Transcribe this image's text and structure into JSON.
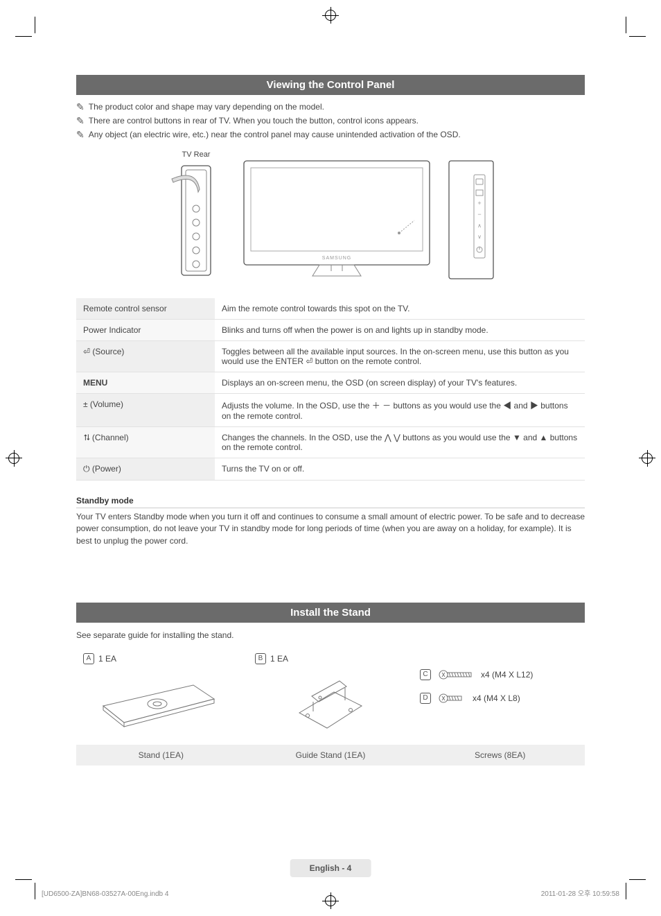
{
  "section1": {
    "title": "Viewing the Control Panel",
    "notes": [
      "The product color and shape may vary depending on the model.",
      "There are control buttons in rear of TV. When you touch the button, control icons appears.",
      "Any object (an electric wire, etc.) near the control panel may cause unintended activation of the OSD."
    ],
    "tv_rear_label": "TV Rear",
    "table": [
      {
        "label": "Remote control sensor",
        "desc": "Aim the remote control towards this spot on the TV."
      },
      {
        "label": "Power Indicator",
        "desc": "Blinks and turns off when the power is on and lights up in standby mode."
      },
      {
        "label": "⏎ (Source)",
        "desc": "Toggles between all the available input sources. In the on-screen menu, use this button as you would use the ENTER ⏎ button on the remote control."
      },
      {
        "label": "MENU",
        "desc": "Displays an on-screen menu, the OSD (on screen display) of your TV's features."
      },
      {
        "label": "± (Volume)",
        "desc": "Adjusts the volume. In the OSD, use the ＋ － buttons as you would use the ◀ and ▶ buttons on the remote control."
      },
      {
        "label": "⮁ (Channel)",
        "desc": "Changes the channels. In the OSD, use the ⋀ ⋁ buttons as you would use the ▼ and ▲ buttons on the remote control."
      },
      {
        "label": "⏻ (Power)",
        "desc": "Turns the TV on or off."
      }
    ],
    "standby_heading": "Standby mode",
    "standby_text": "Your TV enters Standby mode when you turn it off and continues to consume a small amount of electric power. To be safe and to decrease power consumption, do not leave your TV in standby mode for long periods of time (when you are away on a holiday, for example). It is best to unplug the power cord."
  },
  "section2": {
    "title": "Install the Stand",
    "intro": "See separate guide for installing the stand.",
    "items": {
      "a": {
        "badge": "A",
        "qty": "1 EA"
      },
      "b": {
        "badge": "B",
        "qty": "1 EA"
      },
      "c": {
        "badge": "C",
        "text": "x4 (M4 X L12)"
      },
      "d": {
        "badge": "D",
        "text": "x4 (M4 X L8)"
      }
    },
    "captions": [
      "Stand (1EA)",
      "Guide Stand (1EA)",
      "Screws (8EA)"
    ]
  },
  "footer": {
    "page_label": "English - 4",
    "meta_left": "[UD6500-ZA]BN68-03527A-00Eng.indb   4",
    "meta_right": "2011-01-28   오후 10:59:58"
  }
}
